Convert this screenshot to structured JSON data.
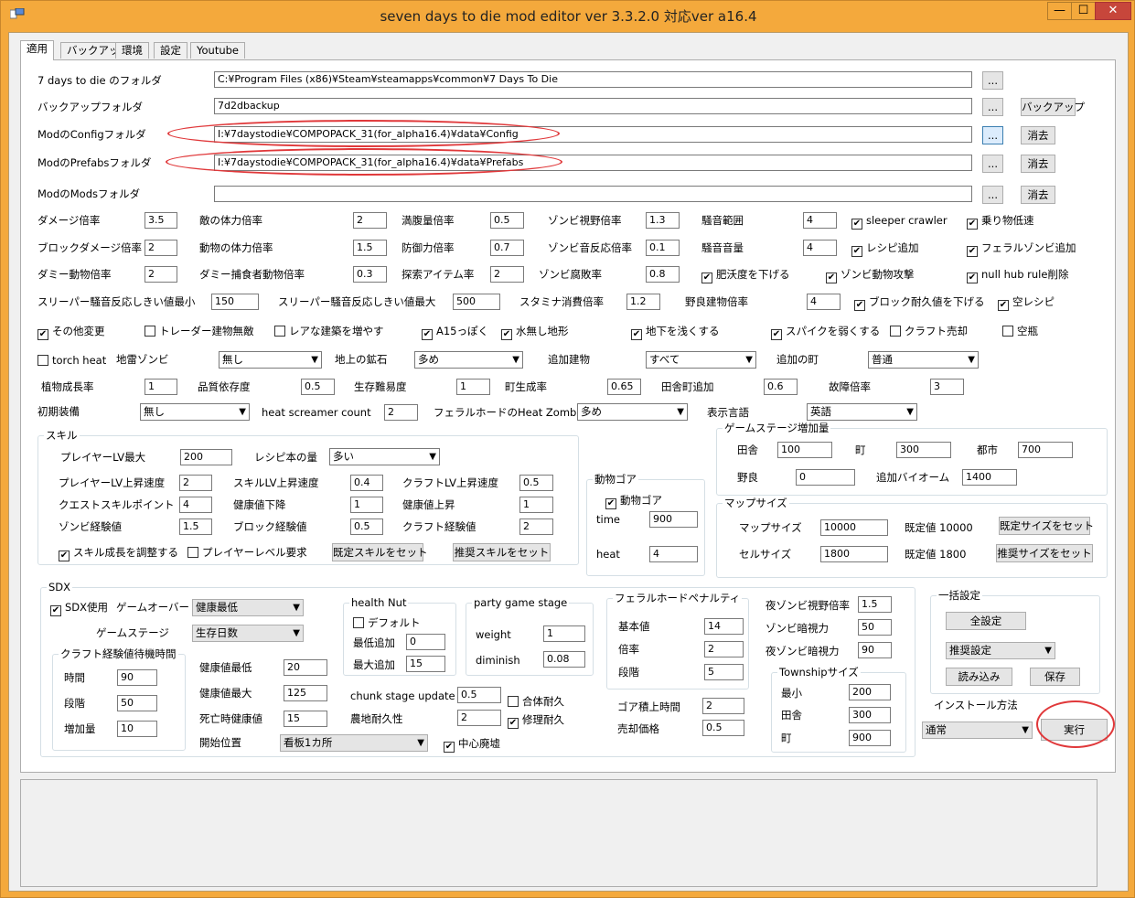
{
  "window": {
    "title": "seven days to die mod editor ver 3.3.2.0 対応ver a16.4",
    "minimize": "—",
    "maximize": "☐",
    "close": "✕"
  },
  "tabs": [
    "適用",
    "バックアップ",
    "環境",
    "設定",
    "Youtube"
  ],
  "folders": {
    "game": {
      "label": "7 days to die のフォルダ",
      "value": "C:¥Program Files (x86)¥Steam¥steamapps¥common¥7 Days To Die"
    },
    "backup": {
      "label": "バックアップフォルダ",
      "value": "7d2dbackup"
    },
    "config": {
      "label": "ModのConfigフォルダ",
      "value": "I:¥7daystodie¥COMPOPACK_31(for_alpha16.4)¥data¥Config"
    },
    "prefabs": {
      "label": "ModのPrefabsフォルダ",
      "value": "I:¥7daystodie¥COMPOPACK_31(for_alpha16.4)¥data¥Prefabs"
    },
    "mods": {
      "label": "ModのModsフォルダ",
      "value": ""
    },
    "browse": "...",
    "backup_btn": "バックアップ",
    "clear": "消去"
  },
  "multipliers": [
    {
      "label": "ダメージ倍率",
      "value": "3.5"
    },
    {
      "label": "敵の体力倍率",
      "value": "2"
    },
    {
      "label": "満腹量倍率",
      "value": "0.5"
    },
    {
      "label": "ゾンビ視野倍率",
      "value": "1.3"
    },
    {
      "label": "騒音範囲",
      "value": "4"
    },
    {
      "label": "ブロックダメージ倍率",
      "value": "2"
    },
    {
      "label": "動物の体力倍率",
      "value": "1.5"
    },
    {
      "label": "防御力倍率",
      "value": "0.7"
    },
    {
      "label": "ゾンビ音反応倍率",
      "value": "0.1"
    },
    {
      "label": "騒音音量",
      "value": "4"
    },
    {
      "label": "ダミー動物倍率",
      "value": "2"
    },
    {
      "label": "ダミー捕食者動物倍率",
      "value": "0.3"
    },
    {
      "label": "探索アイテム率",
      "value": "2"
    },
    {
      "label": "ゾンビ腐敗率",
      "value": "0.8"
    }
  ],
  "sleeper": [
    {
      "label": "スリーパー騒音反応しきい値最小",
      "value": "150"
    },
    {
      "label": "スリーパー騒音反応しきい値最大",
      "value": "500"
    },
    {
      "label": "スタミナ消費倍率",
      "value": "1.2"
    },
    {
      "label": "野良建物倍率",
      "value": "4"
    }
  ],
  "checks": {
    "sleeper_crawler": "sleeper crawler",
    "vehicle_slow": "乗り物低速",
    "recipe_add": "レシピ追加",
    "feral_add": "フェラルゾンビ追加",
    "fertility": "肥沃度を下げる",
    "zombie_animal": "ゾンビ動物攻撃",
    "null_hub": "null hub rule削除",
    "block_dur": "ブロック耐久値を下げる",
    "empty_recipe": "空レシピ",
    "other": "その他変更",
    "trader": "トレーダー建物無敵",
    "rare": "レアな建築を増やす",
    "a15": "A15っぽく",
    "waterless": "水無し地形",
    "shallow": "地下を浅くする",
    "spike": "スパイクを弱くする",
    "craft_sell": "クラフト売却",
    "empty_bottle": "空瓶",
    "torch": "torch heat"
  },
  "world": {
    "landmine": {
      "label": "地雷ゾンビ",
      "value": "無し"
    },
    "ore": {
      "label": "地上の鉱石",
      "value": "多め"
    },
    "extra_bld": {
      "label": "追加建物",
      "value": "すべて"
    },
    "extra_town": {
      "label": "追加の町",
      "value": "普通"
    }
  },
  "growth": [
    {
      "label": "植物成長率",
      "value": "1"
    },
    {
      "label": "品質依存度",
      "value": "0.5"
    },
    {
      "label": "生存難易度",
      "value": "1"
    },
    {
      "label": "町生成率",
      "value": "0.65"
    },
    {
      "label": "田舎町追加",
      "value": "0.6"
    },
    {
      "label": "故障倍率",
      "value": "3"
    }
  ],
  "init": {
    "equip_label": "初期装備",
    "equip_value": "無し",
    "screamer_label": "heat screamer count",
    "screamer_value": "2",
    "horde_label": "フェラルホードのHeat Zombie量",
    "horde_value": "多め",
    "lang_label": "表示言語",
    "lang_value": "英語"
  },
  "skill": {
    "title": "スキル",
    "lvmax_label": "プレイヤーLV最大",
    "lvmax": "200",
    "book_label": "レシピ本の量",
    "book": "多い",
    "rows": [
      {
        "label": "プレイヤーLV上昇速度",
        "value": "2"
      },
      {
        "label": "スキルLV上昇速度",
        "value": "0.4"
      },
      {
        "label": "クラフトLV上昇速度",
        "value": "0.5"
      },
      {
        "label": "クエストスキルポイント",
        "value": "4"
      },
      {
        "label": "健康値下降",
        "value": "1"
      },
      {
        "label": "健康値上昇",
        "value": "1"
      },
      {
        "label": "ゾンビ経験値",
        "value": "1.5"
      },
      {
        "label": "ブロック経験値",
        "value": "0.5"
      },
      {
        "label": "クラフト経験値",
        "value": "2"
      }
    ],
    "adjust": "スキル成長を調整する",
    "req": "プレイヤーレベル要求",
    "default_btn": "既定スキルをセット",
    "recommend_btn": "推奨スキルをセット"
  },
  "gore": {
    "title": "動物ゴア",
    "check": "動物ゴア",
    "time_label": "time",
    "time": "900",
    "heat_label": "heat",
    "heat": "4"
  },
  "gamestage": {
    "title": "ゲームステージ増加量",
    "rural_label": "田舎",
    "rural": "100",
    "town_label": "町",
    "town": "300",
    "city_label": "都市",
    "city": "700",
    "wild_label": "野良",
    "wild": "0",
    "biome_label": "追加バイオーム",
    "biome": "1400"
  },
  "mapsize": {
    "title": "マップサイズ",
    "map_label": "マップサイズ",
    "map": "10000",
    "map_def": "既定値 10000",
    "cell_label": "セルサイズ",
    "cell": "1800",
    "cell_def": "既定値 1800",
    "def_btn": "既定サイズをセット",
    "rec_btn": "推奨サイズをセット"
  },
  "sdx": {
    "title": "SDX",
    "use": "SDX使用",
    "gameover_label": "ゲームオーバー",
    "gameover": "健康最低",
    "stage_label": "ゲームステージ",
    "stage": "生存日数",
    "craft_title": "クラフト経験値待機時間",
    "time_label": "時間",
    "time": "90",
    "step_label": "段階",
    "step": "50",
    "inc_label": "増加量",
    "inc": "10",
    "hmin_label": "健康値最低",
    "hmin": "20",
    "hmax_label": "健康値最大",
    "hmax": "125",
    "death_label": "死亡時健康値",
    "death": "15",
    "start_label": "開始位置",
    "start": "看板1カ所",
    "center": "中心廃墟",
    "nut_title": "health Nut",
    "nut_default": "デフォルト",
    "nut_min_label": "最低追加",
    "nut_min": "0",
    "nut_max_label": "最大追加",
    "nut_max": "15",
    "party_title": "party game stage",
    "weight_label": "weight",
    "weight": "1",
    "dim_label": "diminish",
    "dim": "0.08",
    "chunk_label": "chunk stage update",
    "chunk": "0.5",
    "farm_label": "農地耐久性",
    "farm": "2",
    "merge": "合体耐久",
    "repair": "修理耐久",
    "feral_title": "フェラルホードペナルティ",
    "base_label": "基本値",
    "base": "14",
    "mult_label": "倍率",
    "mult": "2",
    "lvl_label": "段階",
    "lvl": "5",
    "gore_label": "ゴア積上時間",
    "gore": "2",
    "sell_label": "売却価格",
    "sell": "0.5",
    "nsight_label": "夜ゾンビ視野倍率",
    "nsight": "1.5",
    "zdark_label": "ゾンビ暗視力",
    "zdark": "50",
    "ndark_label": "夜ゾンビ暗視力",
    "ndark": "90",
    "town_title": "Townshipサイズ",
    "tmin_label": "最小",
    "tmin": "200",
    "trural_label": "田舎",
    "trural": "300",
    "ttown_label": "町",
    "ttown": "900"
  },
  "bulk": {
    "title": "一括設定",
    "all": "全設定",
    "preset": "推奨設定",
    "load": "読み込み",
    "save": "保存",
    "install_label": "インストール方法",
    "install": "通常",
    "run": "実行"
  },
  "colors": {
    "titlebar": "#f4a93c",
    "highlight": "#e0383a"
  }
}
